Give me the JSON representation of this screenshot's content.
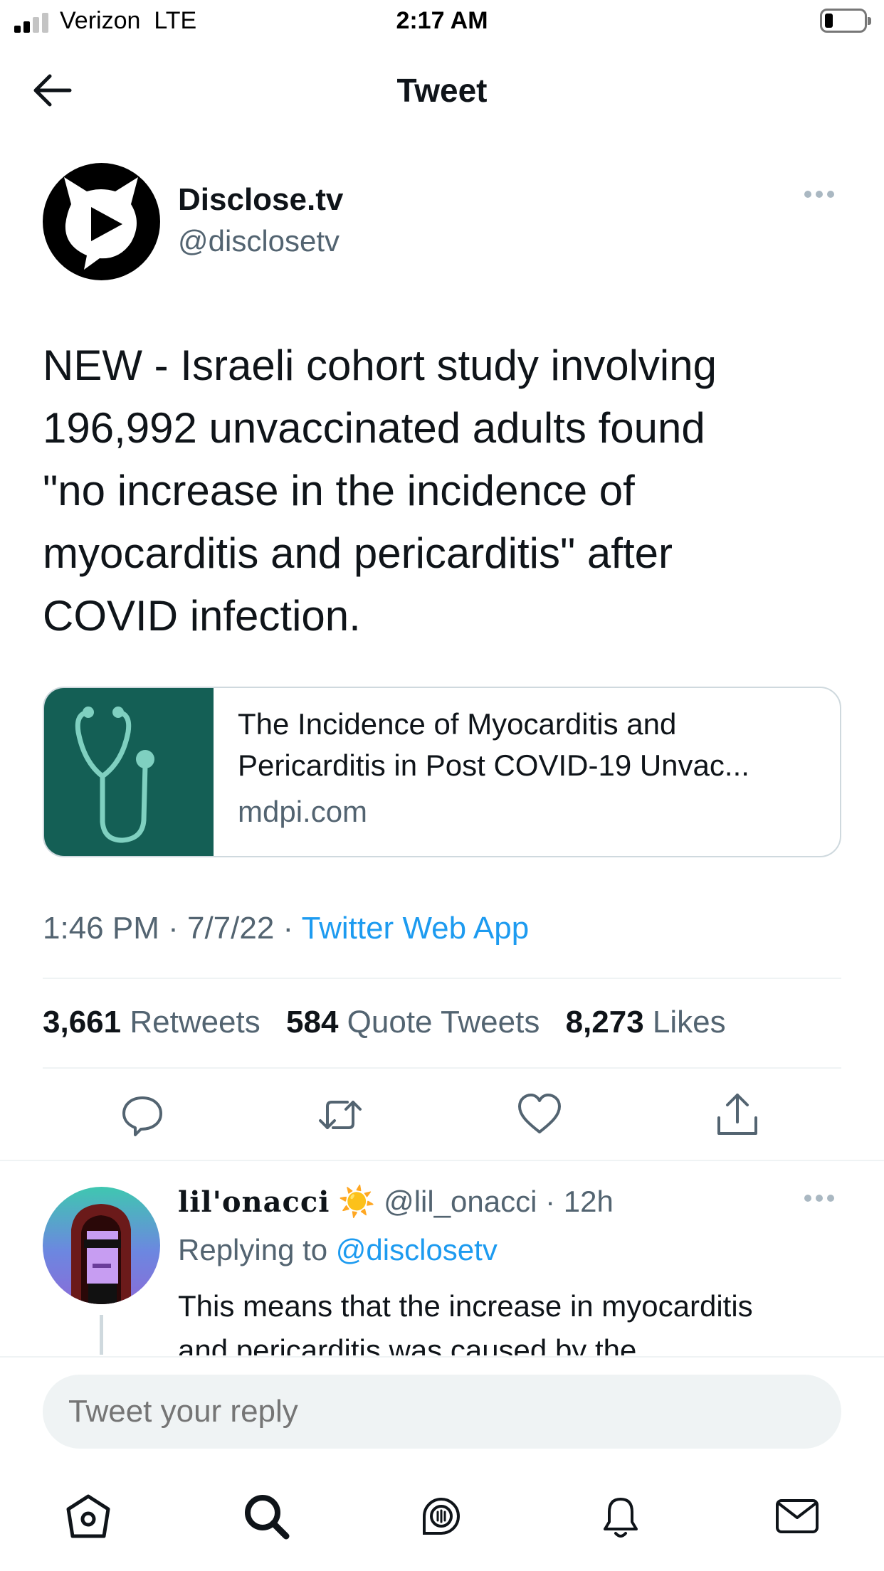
{
  "status_bar": {
    "carrier": "Verizon",
    "network": "LTE",
    "time": "2:17 AM",
    "battery_level": 0.2
  },
  "header": {
    "title": "Tweet",
    "back_icon": "arrow-left-icon"
  },
  "tweet": {
    "author": {
      "name": "Disclose.tv",
      "handle": "@disclosetv",
      "avatar_icon": "play-cat-logo-icon"
    },
    "text_lines": [
      "NEW - Israeli cohort study involving",
      "196,992 unvaccinated adults found",
      "\"no increase in the incidence of",
      "myocarditis and pericarditis\" after",
      "COVID infection."
    ],
    "link_card": {
      "title_lines": [
        "The Incidence of Myocarditis and",
        "Pericarditis in Post COVID-19 Unvac..."
      ],
      "domain": "mdpi.com",
      "thumb_icon": "stethoscope-icon",
      "thumb_color": "#145f55"
    },
    "meta": {
      "time": "1:46 PM",
      "separator": " · ",
      "date": "7/7/22",
      "app": "Twitter Web App"
    },
    "stats": {
      "retweets_count": "3,661",
      "retweets_label": "Retweets",
      "quotes_count": "584",
      "quotes_label": "Quote Tweets",
      "likes_count": "8,273",
      "likes_label": "Likes"
    },
    "actions": [
      "reply-icon",
      "retweet-icon",
      "like-icon",
      "share-icon"
    ]
  },
  "reply": {
    "name": "lil'onacci",
    "emoji": "☀️",
    "handle": "@lil_onacci",
    "time": "· 12h",
    "replying_label": "Replying to",
    "replying_handle": "@disclosetv",
    "text_lines": [
      "This means that the increase in myocarditis",
      "and pericarditis was caused by the"
    ]
  },
  "composer": {
    "placeholder": "Tweet your reply"
  },
  "tab_bar": [
    "home-icon",
    "search-icon",
    "spaces-icon",
    "notifications-icon",
    "messages-icon"
  ],
  "colors": {
    "accent": "#1d9bf0",
    "text_primary": "#0f1419",
    "text_secondary": "#536471",
    "divider": "#eff3f4"
  }
}
